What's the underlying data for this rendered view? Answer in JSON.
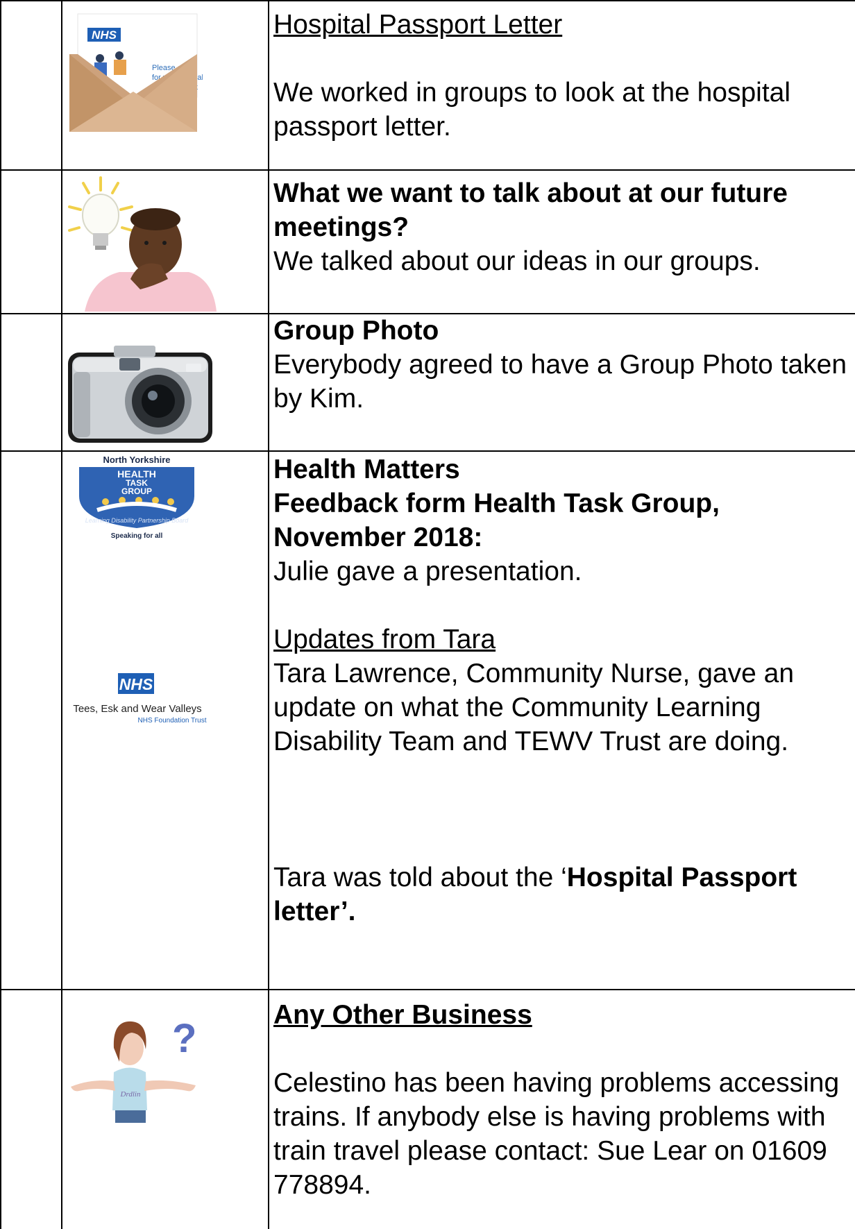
{
  "rows": [
    {
      "image": {
        "icon": "nhs-letter-envelope-icon",
        "nhs_logo": "NHS",
        "letter_text": "Please come for your Annual Health Check"
      },
      "heading": "Hospital Passport Letter",
      "body": "We worked in groups to look at the hospital passport letter."
    },
    {
      "image": {
        "icon": "thinking-man-lightbulb-icon"
      },
      "heading": "What we want to talk about at our future meetings?",
      "body": "We talked about our ideas in our groups."
    },
    {
      "image": {
        "icon": "camera-icon"
      },
      "heading": "Group Photo",
      "body": "Everybody agreed to have a Group Photo taken by Kim."
    },
    {
      "image": {
        "icon": "health-task-group-logo-icon",
        "logo_top": "North Yorkshire",
        "logo_lines": [
          "HEALTH",
          "TASK",
          "GROUP"
        ],
        "logo_arc": "Learning Disability Partnership Board",
        "logo_bottom": "Speaking for all",
        "tewv_nhs": "NHS",
        "tewv_name": "Tees, Esk and Wear Valleys",
        "tewv_sub": "NHS Foundation Trust"
      },
      "heading_1": "Health Matters",
      "heading_2": "Feedback form Health Task Group, November 2018:",
      "body_1": "Julie gave a presentation.",
      "subheading": "Updates from Tara",
      "body_2": "Tara Lawrence, Community Nurse, gave an update on what the Community Learning Disability Team and TEWV Trust are doing.",
      "body_3_prefix": "Tara was told about the ‘",
      "body_3_bold": "Hospital Passport letter’."
    },
    {
      "image": {
        "icon": "confused-woman-question-icon"
      },
      "heading": "Any Other Business",
      "body": "Celestino has been having problems accessing trains. If anybody else is having problems with train travel please contact: Sue Lear on 01609 778894."
    }
  ]
}
